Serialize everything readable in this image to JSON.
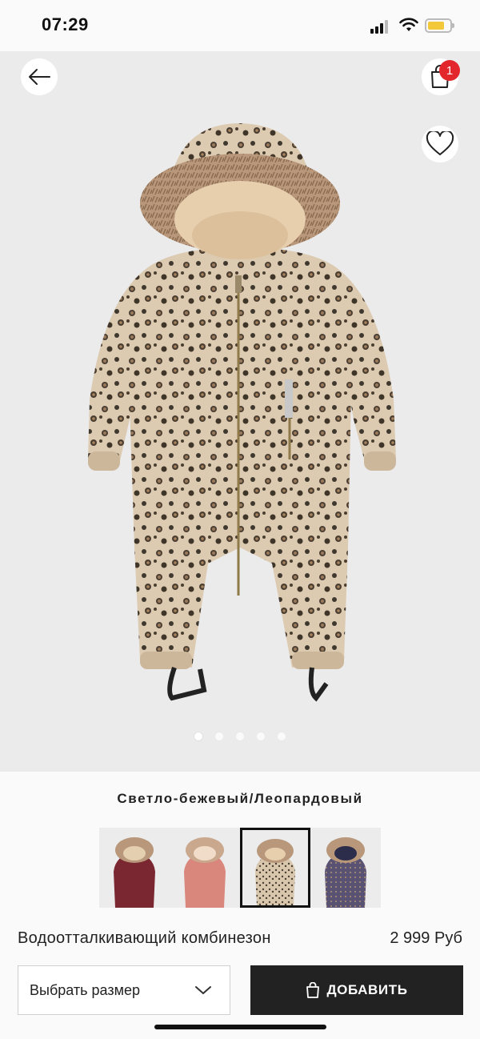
{
  "status": {
    "time": "07:29"
  },
  "header": {
    "cart_count": "1"
  },
  "gallery": {
    "image_count": 5,
    "active_index": 0
  },
  "product": {
    "color_name": "Светло-бежевый/Леопардовый",
    "title": "Водоотталкивающий комбинезон",
    "price": "2 999 Руб",
    "swatches": [
      {
        "color": "#7a2732",
        "selected": false
      },
      {
        "color": "#d9877c",
        "selected": false
      },
      {
        "color": "#d8c6ad",
        "selected": true
      },
      {
        "color": "#5a5272",
        "selected": false
      }
    ]
  },
  "actions": {
    "size_placeholder": "Выбрать размер",
    "add_label": "ДОБАВИТЬ"
  },
  "colors": {
    "accent": "#222222",
    "badge": "#e3262b",
    "battery": "#f2c73a"
  }
}
